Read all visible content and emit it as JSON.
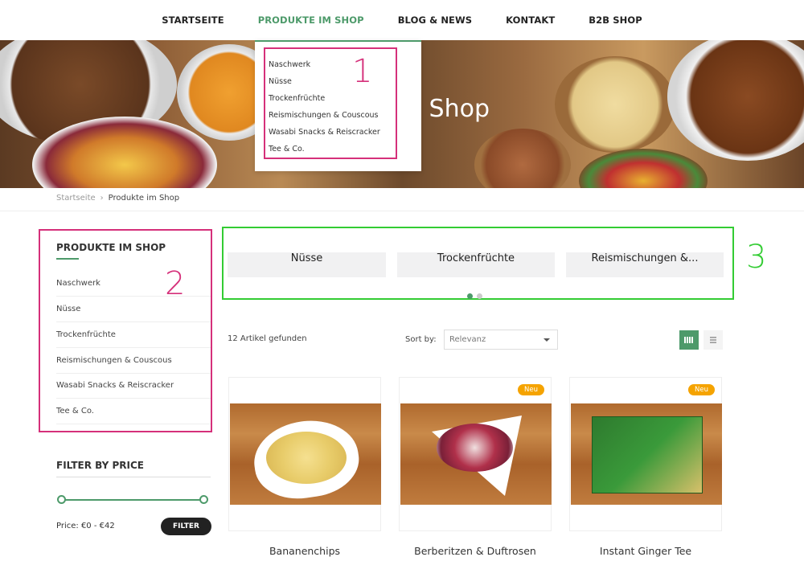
{
  "nav": {
    "items": [
      {
        "label": "STARTSEITE"
      },
      {
        "label": "PRODUKTE IM SHOP"
      },
      {
        "label": "BLOG & NEWS"
      },
      {
        "label": "KONTAKT"
      },
      {
        "label": "B2B SHOP"
      }
    ],
    "active_color": "#4d9a6a"
  },
  "hero": {
    "title": "n Shop"
  },
  "dropdown": {
    "items": [
      "Naschwerk",
      "Nüsse",
      "Trockenfrüchte",
      "Reismischungen & Couscous",
      "Wasabi Snacks & Reiscracker",
      "Tee & Co."
    ]
  },
  "annotations": {
    "one": "1",
    "two": "2",
    "three": "3"
  },
  "breadcrumb": {
    "home": "Startseite",
    "separator": "›",
    "current": "Produkte im Shop"
  },
  "sidebar": {
    "title": "PRODUKTE IM SHOP",
    "items": [
      "Naschwerk",
      "Nüsse",
      "Trockenfrüchte",
      "Reismischungen & Couscous",
      "Wasabi Snacks & Reiscracker",
      "Tee & Co."
    ]
  },
  "filter": {
    "title": "FILTER BY PRICE",
    "price_label": "Price: €0 - €42",
    "button": "FILTER"
  },
  "categories": [
    "Nüsse",
    "Trockenfrüchte",
    "Reismischungen &..."
  ],
  "toolbar": {
    "count": "12 Artikel gefunden",
    "sort_label": "Sort by:",
    "sort_value": "Relevanz",
    "grid_icon": "grid-view-icon",
    "list_icon": "list-view-icon"
  },
  "products": [
    {
      "name": "Bananenchips",
      "badge": ""
    },
    {
      "name": "Berberitzen & Duftrosen",
      "badge": "Neu"
    },
    {
      "name": "Instant Ginger Tee",
      "badge": "Neu"
    }
  ],
  "colors": {
    "accent": "#4d9a6a",
    "annotation_pink": "#d5307a",
    "annotation_green": "#33cc33",
    "badge": "#f5a300"
  }
}
